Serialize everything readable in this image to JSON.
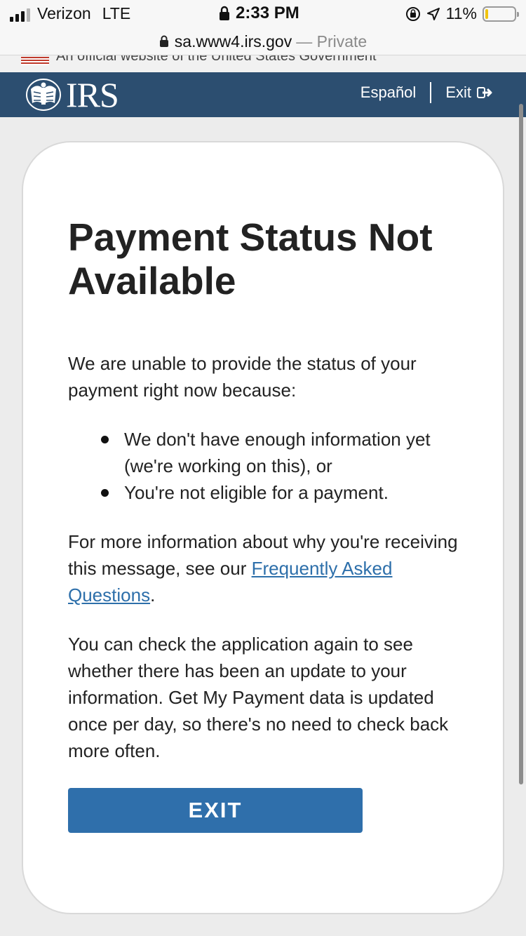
{
  "status_bar": {
    "carrier": "Verizon",
    "network": "LTE",
    "time": "2:33 PM",
    "battery": "11%",
    "battery_level": 0.11,
    "battery_color": "#f1c40f"
  },
  "url_bar": {
    "domain": "sa.www4.irs.gov",
    "separator": " — ",
    "mode": "Private"
  },
  "gov_banner": {
    "text": "An official website of the United States Government"
  },
  "header": {
    "logo": "IRS",
    "language_link": "Español",
    "exit_link": "Exit",
    "background": "#2c4e70"
  },
  "main": {
    "title": "Payment Status Not Available",
    "intro": "We are unable to provide the status of your payment right now because:",
    "reasons": [
      "We don't have enough information yet (we're working on this), or",
      "You're not eligible for a payment."
    ],
    "more_info_prefix": "For more information about why you're receiving this message, see our ",
    "faq_link": "Frequently Asked Questions",
    "more_info_suffix": ".",
    "check_again": "You can check the application again to see whether there has been an update to your information. Get My Payment data is updated once per day, so there's no need to check back more often.",
    "exit_button": "EXIT",
    "link_color": "#2d6faa",
    "button_color": "#2f6fab"
  }
}
